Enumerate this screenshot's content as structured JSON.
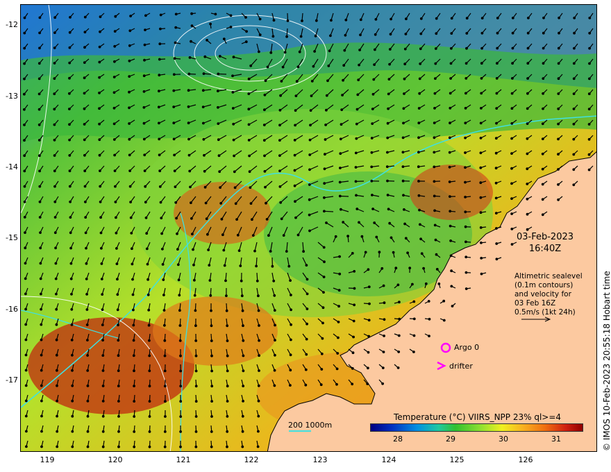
{
  "map": {
    "date": "03-Feb-2023",
    "time": "16:40Z",
    "note_lines": [
      "Altimetric sealevel",
      "(0.1m contours)",
      "and velocity for",
      "03 Feb 16Z",
      "0.5m/s (1kt 24h)"
    ],
    "lat_ticks": [
      "-12",
      "-13",
      "-14",
      "-15",
      "-16",
      "-17"
    ],
    "lon_ticks": [
      "119",
      "120",
      "121",
      "122",
      "123",
      "124",
      "125",
      "126"
    ],
    "argo_label": "Argo 0",
    "drifter_label": "drifter",
    "depth_legend": "200  1000m",
    "colorbar_title": "Temperature (°C) VIIRS_NPP 23% ql>=4",
    "colorbar_ticks": [
      "28",
      "29",
      "30",
      "31"
    ],
    "credit": "© IMOS 10-Feb-2023 20:55:18 Hobart time",
    "colors": {
      "land": "#fcc9a0",
      "argo": "#ff00ff",
      "drifter": "#ff00ff",
      "isobath": "#40e0e0"
    }
  }
}
